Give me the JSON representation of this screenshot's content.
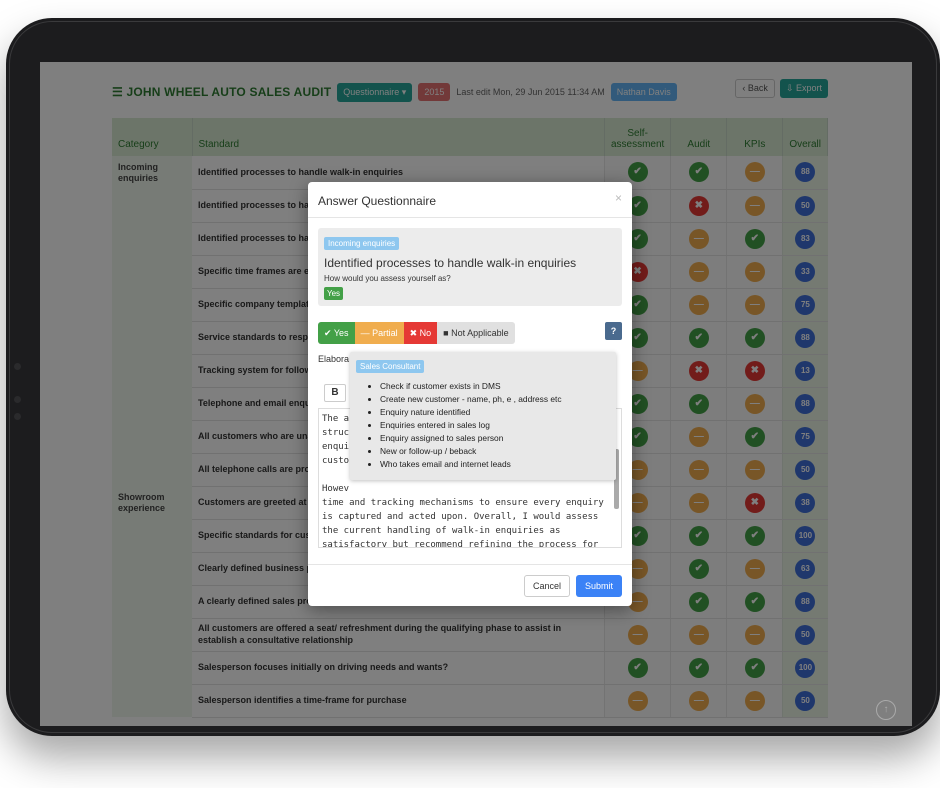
{
  "header": {
    "title": "JOHN WHEEL AUTO SALES AUDIT",
    "questionnaire_label": "Questionnaire ▾",
    "year": "2015",
    "last_edit": "Last edit Mon, 29 Jun 2015 11:34 AM",
    "user": "Nathan Davis",
    "back_label": "‹ Back",
    "export_label": "⇩ Export"
  },
  "table": {
    "columns": {
      "category": "Category",
      "standard": "Standard",
      "self": "Self-assessment",
      "audit": "Audit",
      "kpis": "KPIs",
      "overall": "Overall"
    },
    "rows": [
      {
        "category": "Incoming enquiries",
        "standard": "Identified processes to handle walk-in enquiries",
        "self": "y",
        "audit": "y",
        "kpis": "p",
        "overall": "88"
      },
      {
        "category": "",
        "standard": "Identified processes to ha",
        "self": "y",
        "audit": "n",
        "kpis": "p",
        "overall": "50"
      },
      {
        "category": "",
        "standard": "Identified processes to ha",
        "self": "y",
        "audit": "p",
        "kpis": "y",
        "overall": "83"
      },
      {
        "category": "",
        "standard": "Specific time frames are e",
        "self": "n",
        "audit": "p",
        "kpis": "p",
        "overall": "33"
      },
      {
        "category": "",
        "standard": "Specific company templat",
        "self": "y",
        "audit": "p",
        "kpis": "p",
        "overall": "75"
      },
      {
        "category": "",
        "standard": "Service standards to respo",
        "self": "y",
        "audit": "y",
        "kpis": "y",
        "overall": "88"
      },
      {
        "category": "",
        "standard": "Tracking system for follow",
        "self": "p",
        "audit": "n",
        "kpis": "n",
        "overall": "13"
      },
      {
        "category": "",
        "standard": "Telephone and email enqu",
        "self": "y",
        "audit": "y",
        "kpis": "p",
        "overall": "88"
      },
      {
        "category": "",
        "standard": "All customers who are una needs",
        "self": "y",
        "audit": "p",
        "kpis": "y",
        "overall": "75"
      },
      {
        "category": "",
        "standard": "All telephone calls are pro customer",
        "self": "p",
        "audit": "p",
        "kpis": "p",
        "overall": "50"
      },
      {
        "category": "Showroom experience",
        "standard": "Customers are greeted at",
        "self": "p",
        "audit": "p",
        "kpis": "n",
        "overall": "38"
      },
      {
        "category": "",
        "standard": "Specific standards for cust",
        "self": "y",
        "audit": "y",
        "kpis": "y",
        "overall": "100"
      },
      {
        "category": "",
        "standard": "Clearly defined business p grooming/ deportment",
        "self": "p",
        "audit": "y",
        "kpis": "p",
        "overall": "63"
      },
      {
        "category": "",
        "standard": "A clearly defined sales pro journey- including trade in valuation",
        "self": "p",
        "audit": "y",
        "kpis": "y",
        "overall": "88"
      },
      {
        "category": "",
        "standard": "All customers are offered a seat/ refreshment during the qualifying phase to assist in establish a consultative relationship",
        "self": "p",
        "audit": "p",
        "kpis": "p",
        "overall": "50"
      },
      {
        "category": "",
        "standard": "Salesperson focuses initially on driving needs and wants?",
        "self": "y",
        "audit": "y",
        "kpis": "y",
        "overall": "100"
      },
      {
        "category": "",
        "standard": "Salesperson identifies a time-frame for purchase",
        "self": "p",
        "audit": "p",
        "kpis": "p",
        "overall": "50"
      }
    ]
  },
  "modal": {
    "title": "Answer Questionnaire",
    "close": "×",
    "tag": "Incoming enquiries",
    "question": "Identified processes to handle walk-in enquiries",
    "prompt": "How would you assess yourself as?",
    "answer": "Yes",
    "options": {
      "yes": "✔ Yes",
      "partial": "— Partial",
      "no": "✖ No",
      "na": "Not Applicable"
    },
    "help": "?",
    "elaborate": "Elabora",
    "bold": "B",
    "text": "The a\nstruc\nenqui\ncusto\n\nHowev\ntime and tracking mechanisms to ensure every enquiry\nis captured and acted upon. Overall, I would assess\nthe current handling of walk-in enquiries as\nsatisfactory but recommend refining the process for",
    "tooltip": {
      "tag": "Sales Consultant",
      "items": [
        "Check if customer exists in DMS",
        "Create new customer - name, ph, e , address etc",
        "Enquiry nature identified",
        "Enquiries entered in sales log",
        "Enquiry assigned to sales person",
        "New or follow-up / beback",
        "Who takes email and internet leads"
      ]
    },
    "cancel": "Cancel",
    "submit": "Submit"
  },
  "colors": {
    "yes": "#43a047",
    "partial": "#f0ad4e",
    "no": "#e53935",
    "overall": "#3f6fd8",
    "accent": "#26a69a"
  },
  "scroll_top_icon": "↑"
}
